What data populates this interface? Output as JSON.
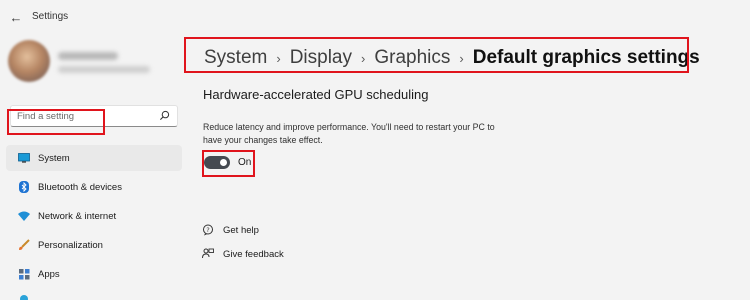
{
  "window": {
    "title": "Settings"
  },
  "search": {
    "placeholder": "Find a setting"
  },
  "sidebar": {
    "items": [
      {
        "label": "System",
        "icon": "monitor-icon",
        "active": true
      },
      {
        "label": "Bluetooth & devices",
        "icon": "bluetooth-icon"
      },
      {
        "label": "Network & internet",
        "icon": "wifi-icon"
      },
      {
        "label": "Personalization",
        "icon": "brush-icon"
      },
      {
        "label": "Apps",
        "icon": "apps-icon"
      }
    ]
  },
  "breadcrumb": {
    "items": [
      "System",
      "Display",
      "Graphics"
    ],
    "current": "Default graphics settings",
    "separator": "›"
  },
  "section": {
    "title": "Hardware-accelerated GPU scheduling",
    "description": "Reduce latency and improve performance. You'll need to restart your PC to have your changes take effect.",
    "toggle_label": "On",
    "toggle_on": true
  },
  "links": {
    "help": "Get help",
    "feedback": "Give feedback"
  },
  "colors": {
    "highlight": "#e0141c",
    "toggle": "#454a51",
    "accent": "#0067c0"
  }
}
